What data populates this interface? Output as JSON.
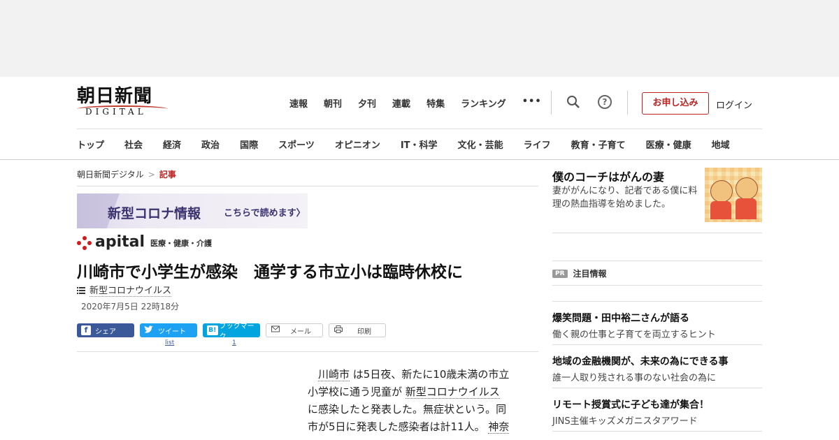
{
  "header": {
    "logo_jp": "朝日新聞",
    "logo_en": "DIGITAL",
    "topnav": [
      "速報",
      "朝刊",
      "夕刊",
      "連載",
      "特集",
      "ランキング"
    ],
    "more": "•••",
    "help": "?",
    "subscribe": "お申し込み",
    "login": "ログイン"
  },
  "catnav": [
    "トップ",
    "社会",
    "経済",
    "政治",
    "国際",
    "スポーツ",
    "オピニオン",
    "IT・科学",
    "文化・芸能",
    "ライフ",
    "教育・子育て",
    "医療・健康",
    "地域"
  ],
  "breadcrumb": {
    "home": "朝日新聞デジタル",
    "sep": ">",
    "current": "記事"
  },
  "banner": {
    "title": "新型コロナ情報",
    "link": "こちらで読めます〉"
  },
  "apital": {
    "word": "apital",
    "category": "医療・健康・介護"
  },
  "article": {
    "title": "川崎市で小学生が感染　通学する市立小は臨時休校に",
    "tag": "新型コロナウイルス",
    "date": "2020年7月5日 22時18分",
    "body": {
      "l1a": "川崎市",
      "l1b": " は5日夜、新たに10歳未満の市立",
      "l2a": "小学校に通う児童が ",
      "l2b": "新型コロナウイルス",
      "l3": "に感染したと発表した。無症状という。同",
      "l4a": "市が5日に発表した感染者は計11人。 ",
      "l4b": "神奈"
    }
  },
  "share": {
    "facebook": "シェア",
    "twitter": "ツイート",
    "hatena": "ブックマーク",
    "hatena_icon": "B!",
    "mail": "メール",
    "print": "印刷",
    "twitter_count": "list",
    "hatena_count": "1"
  },
  "sidebar": {
    "promo_title": "僕のコーチはがんの妻",
    "promo_text": "妻ががんになり、記者である僕に料理の熱血指導を始めました。",
    "pr_badge": "PR",
    "pr_title": "注目情報",
    "items": [
      {
        "title": "爆笑問題・田中裕二さんが語る",
        "sub": "働く親の仕事と子育てを両立するヒント"
      },
      {
        "title": "地域の金融機関が、未来の為にできる事",
        "sub": "誰一人取り残される事のない社会の為に"
      },
      {
        "title": "リモート授賞式に子ども達が集合！",
        "sub": "JINS主催キッズメガニスタアワード"
      }
    ]
  },
  "colors": {
    "brand_red": "#b22222",
    "facebook": "#3b5998",
    "twitter": "#1da1f2",
    "hatena": "#00a4de"
  }
}
